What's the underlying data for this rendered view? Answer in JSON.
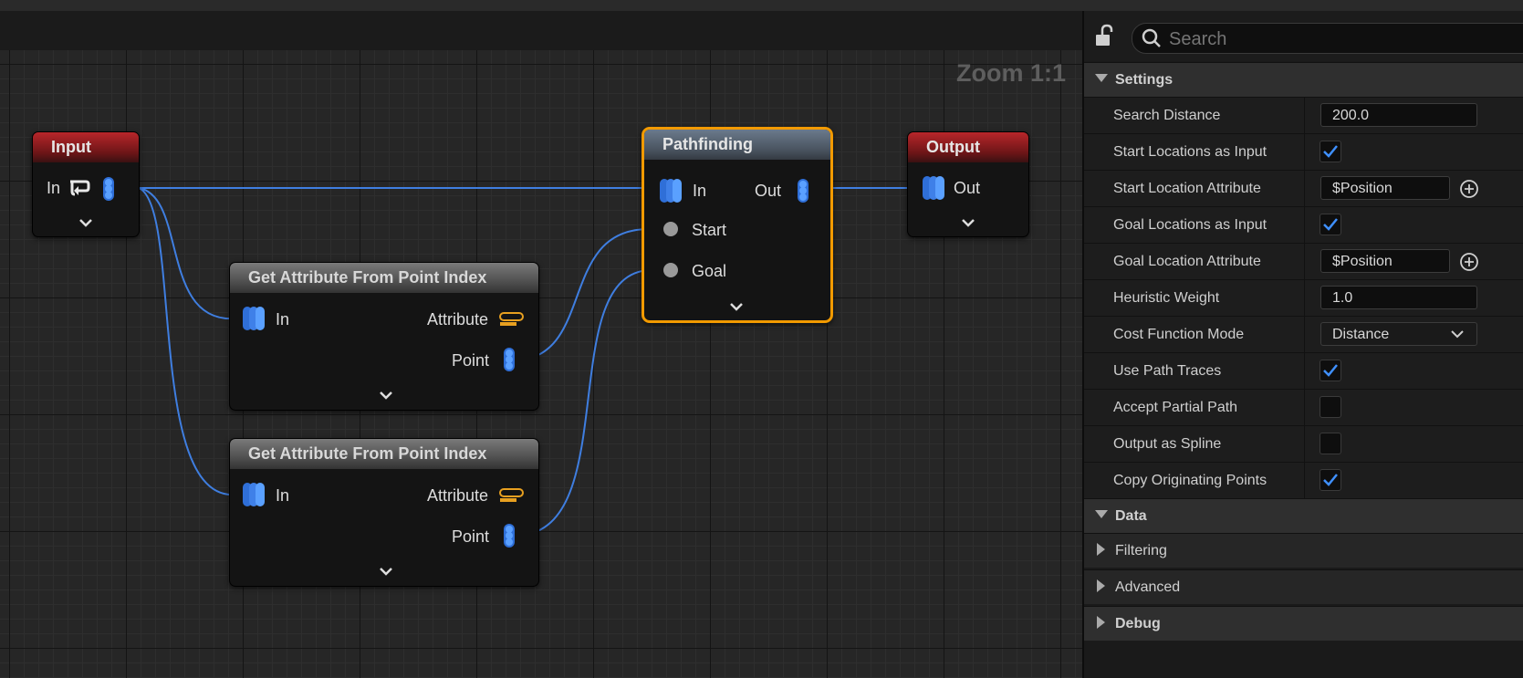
{
  "graph": {
    "zoom_label": "Zoom 1:1",
    "nodes": {
      "input": {
        "title": "Input",
        "pin_in": "In"
      },
      "get_attr_1": {
        "title": "Get Attribute From Point Index",
        "pin_in": "In",
        "pin_attribute": "Attribute",
        "pin_point": "Point"
      },
      "get_attr_2": {
        "title": "Get Attribute From Point Index",
        "pin_in": "In",
        "pin_attribute": "Attribute",
        "pin_point": "Point"
      },
      "pathfinding": {
        "title": "Pathfinding",
        "pin_in": "In",
        "pin_out": "Out",
        "pin_start": "Start",
        "pin_goal": "Goal"
      },
      "output": {
        "title": "Output",
        "pin_out": "Out"
      }
    },
    "colors": {
      "wire": "#3f7ee0",
      "selection": "#f29a00",
      "attribute_pin": "#e8a020"
    }
  },
  "details": {
    "search_placeholder": "Search",
    "sections": {
      "settings": "Settings",
      "data": "Data",
      "filtering": "Filtering",
      "advanced": "Advanced",
      "debug": "Debug"
    },
    "properties": {
      "search_distance": {
        "label": "Search Distance",
        "value": "200.0"
      },
      "start_locations_as_input": {
        "label": "Start Locations as Input",
        "checked": true
      },
      "start_location_attribute": {
        "label": "Start Location Attribute",
        "value": "$Position"
      },
      "goal_locations_as_input": {
        "label": "Goal Locations as Input",
        "checked": true
      },
      "goal_location_attribute": {
        "label": "Goal Location Attribute",
        "value": "$Position"
      },
      "heuristic_weight": {
        "label": "Heuristic Weight",
        "value": "1.0"
      },
      "cost_function_mode": {
        "label": "Cost Function Mode",
        "value": "Distance"
      },
      "use_path_traces": {
        "label": "Use Path Traces",
        "checked": true
      },
      "accept_partial_path": {
        "label": "Accept Partial Path",
        "checked": false
      },
      "output_as_spline": {
        "label": "Output as Spline",
        "checked": false
      },
      "copy_originating_points": {
        "label": "Copy Originating Points",
        "checked": true
      }
    }
  }
}
